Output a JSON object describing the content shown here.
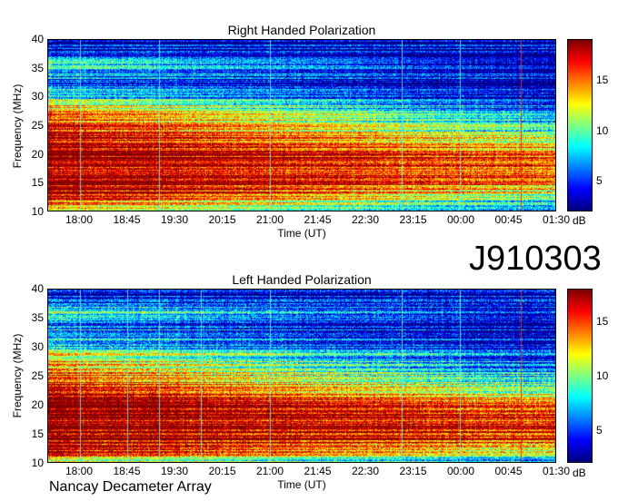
{
  "chart_data": [
    {
      "type": "heatmap",
      "title": "Right Handed Polarization",
      "xlabel": "Time (UT)",
      "ylabel": "Frequency (MHz)",
      "x_ticks": [
        "18:00",
        "18:45",
        "19:30",
        "20:15",
        "21:00",
        "21:45",
        "22:30",
        "23:15",
        "00:00",
        "00:45",
        "01:30"
      ],
      "y_ticks": [
        10,
        15,
        20,
        25,
        30,
        35,
        40
      ],
      "ylim": [
        10,
        40
      ],
      "colorbar": {
        "label": "dB",
        "ticks": [
          5,
          10,
          15
        ],
        "range": [
          2,
          19
        ],
        "colormap": "jet"
      },
      "intensity_profile": {
        "frequencies_mhz": [
          10,
          12,
          14,
          16,
          18,
          20,
          22,
          24,
          26,
          28,
          30,
          32,
          34,
          36,
          38,
          40
        ],
        "early_db": [
          12,
          17,
          19,
          19,
          19,
          19,
          18,
          17,
          15,
          14,
          9,
          7,
          6,
          11,
          4,
          3
        ],
        "late_db": [
          6,
          9,
          13,
          16,
          16,
          14,
          12,
          9,
          7,
          5,
          4,
          3,
          3,
          3,
          3,
          3
        ]
      },
      "vertical_lines_ut": [
        "18:00",
        "19:15",
        "21:00",
        "23:05",
        "00:00",
        "00:58"
      ]
    },
    {
      "type": "heatmap",
      "title": "Left Handed Polarization",
      "xlabel": "Time (UT)",
      "ylabel": "Frequency (MHz)",
      "x_ticks": [
        "18:00",
        "18:45",
        "19:30",
        "20:15",
        "21:00",
        "21:45",
        "22:30",
        "23:15",
        "00:00",
        "00:45",
        "01:30"
      ],
      "y_ticks": [
        10,
        15,
        20,
        25,
        30,
        35,
        40
      ],
      "ylim": [
        10,
        40
      ],
      "colorbar": {
        "label": "dB",
        "ticks": [
          5,
          10,
          15
        ],
        "range": [
          2,
          18
        ],
        "colormap": "jet"
      },
      "intensity_profile": {
        "frequencies_mhz": [
          10,
          12,
          14,
          16,
          18,
          20,
          22,
          24,
          26,
          28,
          30,
          32,
          34,
          36,
          38,
          40
        ],
        "early_db": [
          12,
          17,
          18,
          18,
          18,
          18,
          17,
          15,
          14,
          13,
          8,
          7,
          6,
          9,
          4,
          3
        ],
        "late_db": [
          7,
          11,
          15,
          16,
          15,
          13,
          10,
          8,
          6,
          5,
          4,
          3,
          3,
          3,
          3,
          3
        ]
      },
      "vertical_lines_ut": [
        "18:00",
        "18:45",
        "19:15",
        "19:55",
        "21:00",
        "23:05",
        "00:00",
        "00:58"
      ]
    }
  ],
  "observation_id": "J910303",
  "footer_label": "Nancay Decameter Array"
}
